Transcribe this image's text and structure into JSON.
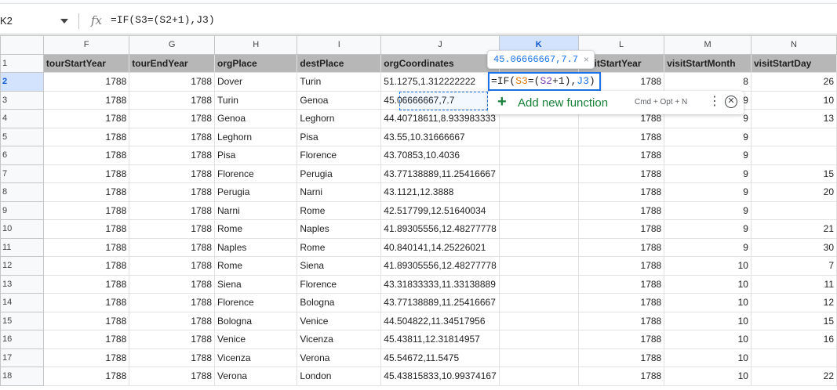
{
  "formula_bar": {
    "cell_ref": "K2",
    "fx_icon": "fx-icon",
    "formula": "=IF(S3=(S2+1),J3)"
  },
  "columns": [
    "F",
    "G",
    "H",
    "I",
    "J",
    "K",
    "L",
    "M",
    "N"
  ],
  "selected_column": "K",
  "header_row": [
    "tourStartYear",
    "tourEndYear",
    "orgPlace",
    "destPlace",
    "orgCoordinates",
    "",
    "visitStartYear",
    "visitStartMonth",
    "visitStartDay"
  ],
  "rows": [
    [
      "1788",
      "1788",
      "Dover",
      "Turin",
      "51.1275,1.312222222",
      "",
      "1788",
      "8",
      "26"
    ],
    [
      "1788",
      "1788",
      "Turin",
      "Genoa",
      "45.06666667,7.7",
      "",
      "1788",
      "9",
      "10"
    ],
    [
      "1788",
      "1788",
      "Genoa",
      "Leghorn",
      "44.40718611,8.933983333",
      "",
      "1788",
      "9",
      "13"
    ],
    [
      "1788",
      "1788",
      "Leghorn",
      "Pisa",
      "43.55,10.31666667",
      "",
      "1788",
      "9",
      ""
    ],
    [
      "1788",
      "1788",
      "Pisa",
      "Florence",
      "43.70853,10.4036",
      "",
      "1788",
      "9",
      ""
    ],
    [
      "1788",
      "1788",
      "Florence",
      "Perugia",
      "43.77138889,11.25416667",
      "",
      "1788",
      "9",
      "15"
    ],
    [
      "1788",
      "1788",
      "Perugia",
      "Narni",
      "43.1121,12.3888",
      "",
      "1788",
      "9",
      "20"
    ],
    [
      "1788",
      "1788",
      "Narni",
      "Rome",
      "42.517799,12.51640034",
      "",
      "1788",
      "9",
      ""
    ],
    [
      "1788",
      "1788",
      "Rome",
      "Naples",
      "41.89305556,12.48277778",
      "",
      "1788",
      "9",
      "21"
    ],
    [
      "1788",
      "1788",
      "Naples",
      "Rome",
      "40.840141,14.25226021",
      "",
      "1788",
      "9",
      "30"
    ],
    [
      "1788",
      "1788",
      "Rome",
      "Siena",
      "41.89305556,12.48277778",
      "",
      "1788",
      "10",
      "7"
    ],
    [
      "1788",
      "1788",
      "Siena",
      "Florence",
      "43.31833333,11.33138889",
      "",
      "1788",
      "10",
      "11"
    ],
    [
      "1788",
      "1788",
      "Florence",
      "Bologna",
      "43.77138889,11.25416667",
      "",
      "1788",
      "10",
      "12"
    ],
    [
      "1788",
      "1788",
      "Bologna",
      "Venice",
      "44.504822,11.34517956",
      "",
      "1788",
      "10",
      "15"
    ],
    [
      "1788",
      "1788",
      "Venice",
      "Vicenza",
      "45.43811,12.31814957",
      "",
      "1788",
      "10",
      "16"
    ],
    [
      "1788",
      "1788",
      "Vicenza",
      "Verona",
      "45.54672,11.5475",
      "",
      "1788",
      "10",
      ""
    ],
    [
      "1788",
      "1788",
      "Verona",
      "London",
      "45.43815833,10.99374167",
      "",
      "1788",
      "10",
      "22"
    ]
  ],
  "editor": {
    "parts": [
      "=IF(",
      "S3",
      "=(",
      "S2",
      "+1),",
      "J3",
      ")"
    ]
  },
  "value_tooltip": {
    "value": "45.06666667,7.7",
    "close": "×"
  },
  "function_popup": {
    "label": "Add new function",
    "shortcut": "Cmd + Opt + N",
    "more_icon": "more-vert-icon",
    "close_icon": "close-circle-icon"
  }
}
